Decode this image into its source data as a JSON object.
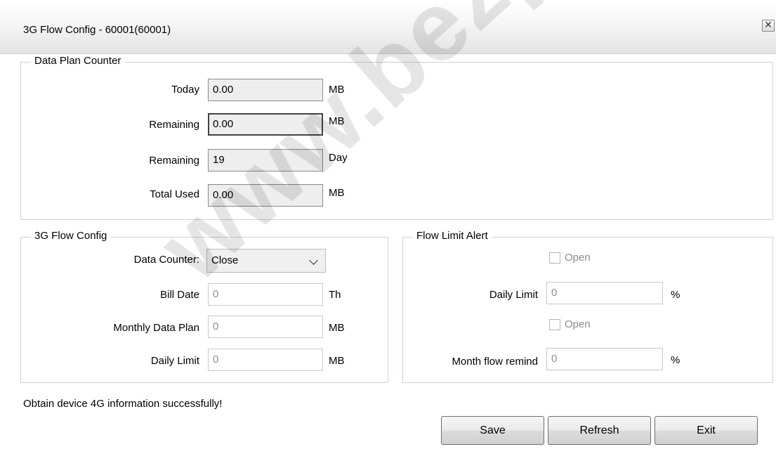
{
  "window": {
    "title": "3G Flow Config - 60001(60001)",
    "close_symbol": "✕"
  },
  "data_plan_counter": {
    "legend": "Data Plan Counter",
    "rows": [
      {
        "label": "Today",
        "value": "0.00",
        "unit": "MB"
      },
      {
        "label": "Remaining",
        "value": "0.00",
        "unit": "MB"
      },
      {
        "label": "Remaining",
        "value": "19",
        "unit": "Day"
      },
      {
        "label": "Total Used",
        "value": "0.00",
        "unit": "MB"
      }
    ]
  },
  "flow_config": {
    "legend": "3G Flow Config",
    "data_counter": {
      "label": "Data Counter:",
      "selected": "Close"
    },
    "bill_date": {
      "label": "Bill Date",
      "value": "0",
      "unit": "Th"
    },
    "monthly_data_plan": {
      "label": "Monthly Data Plan",
      "value": "0",
      "unit": "MB"
    },
    "daily_limit": {
      "label": "Daily Limit",
      "value": "0",
      "unit": "MB"
    }
  },
  "flow_limit_alert": {
    "legend": "Flow Limit Alert",
    "open1": {
      "label": "Open",
      "checked": false
    },
    "daily_limit": {
      "label": "Daily Limit",
      "value": "0",
      "unit": "%"
    },
    "open2": {
      "label": "Open",
      "checked": false
    },
    "month_flow_remind": {
      "label": "Month flow remind",
      "value": "0",
      "unit": "%"
    }
  },
  "status_text": "Obtain device 4G information successfully!",
  "buttons": {
    "save": "Save",
    "refresh": "Refresh",
    "exit": "Exit"
  },
  "watermark": "www.bezpeka-sl"
}
